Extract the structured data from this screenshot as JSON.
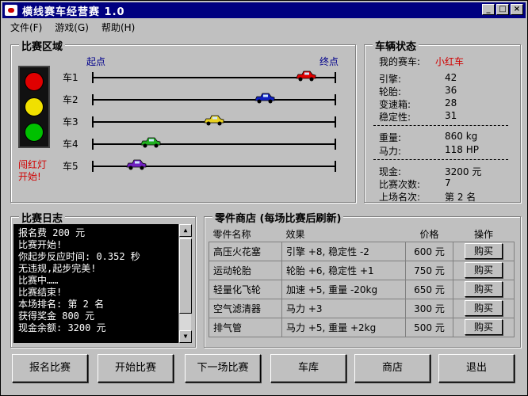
{
  "window": {
    "title": "横线赛车经营赛 1.0",
    "minimize": "_",
    "maximize": "□",
    "close": "×"
  },
  "menu": [
    "文件(F)",
    "游戏(G)",
    "帮助(H)"
  ],
  "race": {
    "legend": "比赛区域",
    "start_label": "起点",
    "finish_label": "终点",
    "light_text_1": "闯红灯",
    "light_text_2": "开始!",
    "lanes": [
      {
        "name": "车1",
        "color": "#e00000",
        "progress": 0.88
      },
      {
        "name": "车2",
        "color": "#1020c0",
        "progress": 0.71
      },
      {
        "name": "车3",
        "color": "#e8d020",
        "progress": 0.5
      },
      {
        "name": "车4",
        "color": "#20b020",
        "progress": 0.24
      },
      {
        "name": "车5",
        "color": "#7020c0",
        "progress": 0.18
      }
    ]
  },
  "status": {
    "legend": "车辆状态",
    "my_car_label": "我的赛车:",
    "my_car_name": "小红车",
    "engine_label": "引擎:",
    "engine": "42",
    "tires_label": "轮胎:",
    "tires": "36",
    "gearbox_label": "变速箱:",
    "gearbox": "28",
    "stability_label": "稳定性:",
    "stability": "31",
    "weight_label": "重量:",
    "weight": "860 kg",
    "power_label": "马力:",
    "power": "118 HP",
    "cash_label": "现金:",
    "cash": "3200 元",
    "races_label": "比赛次数:",
    "races": "7",
    "last_rank_label": "上场名次:",
    "last_rank": "第 2 名"
  },
  "log": {
    "legend": "比赛日志",
    "lines": [
      "报名费 200 元",
      "比赛开始!",
      "你起步反应时间: 0.352 秒",
      "无违规,起步完美!",
      "比赛中……",
      "比赛结束!",
      "本场排名: 第 2 名",
      "获得奖金 800 元",
      "现金余额: 3200 元"
    ]
  },
  "shop": {
    "legend": "零件商店 (每场比赛后刷新)",
    "headers": {
      "name": "零件名称",
      "effect": "效果",
      "price": "价格",
      "action": "操作"
    },
    "buy_label": "购买",
    "items": [
      {
        "name": "高压火花塞",
        "effect": "引擎 +8, 稳定性 -2",
        "price": "600 元"
      },
      {
        "name": "运动轮胎",
        "effect": "轮胎 +6, 稳定性 +1",
        "price": "750 元"
      },
      {
        "name": "轻量化飞轮",
        "effect": "加速 +5, 重量 -20kg",
        "price": "650 元"
      },
      {
        "name": "空气滤清器",
        "effect": "马力 +3",
        "price": "300 元"
      },
      {
        "name": "排气管",
        "effect": "马力 +5, 重量 +2kg",
        "price": "500 元"
      }
    ]
  },
  "buttons": [
    "报名比赛",
    "开始比赛",
    "下一场比赛",
    "车库",
    "商店",
    "退出"
  ],
  "colors": {
    "title_bar": "#000080",
    "face": "#c0c0c0",
    "red_text": "#d00000",
    "blue_text": "#00008b",
    "light_red": "#e00000",
    "light_yellow": "#f0e000",
    "light_green": "#00c000"
  }
}
